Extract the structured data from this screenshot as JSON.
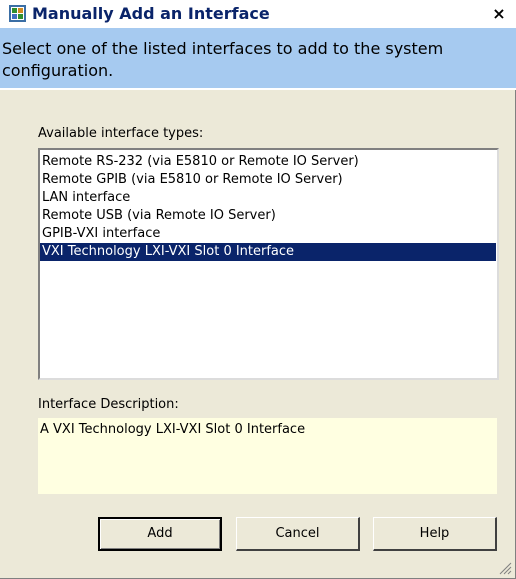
{
  "window": {
    "title": "Manually Add an Interface",
    "close_label": "×"
  },
  "banner": {
    "text": "Select one of the listed interfaces to add to the system configuration."
  },
  "types": {
    "label": "Available interface types:",
    "items": [
      "Remote RS-232 (via E5810 or Remote IO Server)",
      "Remote GPIB (via E5810 or Remote IO Server)",
      "LAN interface",
      "Remote USB (via Remote IO Server)",
      "GPIB-VXI interface",
      "VXI Technology LXI-VXI Slot 0 Interface"
    ],
    "selected_index": 5
  },
  "description": {
    "label": "Interface Description:",
    "text": "A VXI Technology LXI-VXI Slot 0 Interface"
  },
  "buttons": {
    "add": "Add",
    "cancel": "Cancel",
    "help": "Help"
  },
  "colors": {
    "banner": "#a6caf0",
    "selection": "#0a246a",
    "description_bg": "#ffffe1",
    "dialog_bg": "#ece9d8"
  }
}
